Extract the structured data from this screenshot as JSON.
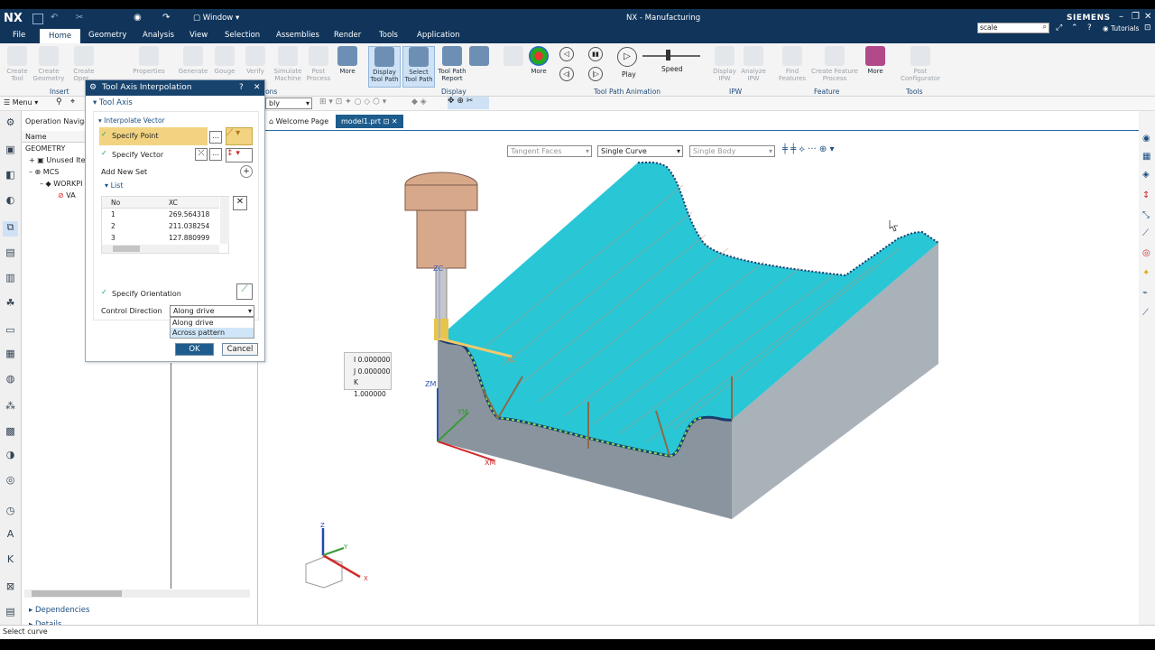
{
  "titlebar": {
    "logo": "NX",
    "window_menu": "Window",
    "app_title": "NX - Manufacturing",
    "brand": "SIEMENS"
  },
  "search": {
    "value": "scale"
  },
  "tutorials": "Tutorials",
  "menubar": {
    "items": [
      "File",
      "Home",
      "Geometry",
      "Analysis",
      "View",
      "Selection",
      "Assemblies",
      "Render",
      "Tools",
      "Application"
    ]
  },
  "ribbon": {
    "insert": [
      {
        "label": "Create Tool"
      },
      {
        "label": "Create Geometry"
      },
      {
        "label": "Create Oper..."
      },
      {
        "label": "Properties"
      },
      {
        "label": "Generate"
      },
      {
        "label": "Gouge"
      },
      {
        "label": "Verify"
      },
      {
        "label": "Simulate Machine"
      },
      {
        "label": "Post Process"
      }
    ],
    "more1": "More",
    "display_buttons": [
      {
        "label": "Display Tool Path"
      },
      {
        "label": "Select Tool Path"
      },
      {
        "label": "Tool Path Report"
      }
    ],
    "more2": "More",
    "play": "Play",
    "speed": "Speed",
    "ipw": [
      {
        "label": "Display IPW"
      },
      {
        "label": "Analyze IPW"
      }
    ],
    "feature": [
      {
        "label": "Find Features"
      },
      {
        "label": "Create Feature Process"
      },
      {
        "label": "More"
      }
    ],
    "tools": [
      {
        "label": "Post Configurator"
      }
    ],
    "groups": {
      "insert": "Insert",
      "ops": "ions",
      "display": "Display",
      "animation": "Tool Path Animation",
      "ipw": "IPW",
      "feature": "Feature",
      "tools": "Tools"
    }
  },
  "toolbar2": {
    "menu": "Menu",
    "assembly_dd": "bly"
  },
  "tabs": [
    {
      "label": "Welcome Page"
    },
    {
      "label": "model1.prt"
    }
  ],
  "navigator": {
    "title": "Operation Navigat",
    "col_name": "Name",
    "root": "GEOMETRY",
    "items": [
      "Unused Item",
      "MCS",
      "WORKPI",
      "VA"
    ],
    "dependencies": "Dependencies",
    "details": "Details"
  },
  "selection_filters": {
    "faces": "Tangent Faces",
    "curve": "Single Curve",
    "body": "Single Body"
  },
  "dialog": {
    "title": "Tool Axis Interpolation",
    "section_tool_axis": "Tool Axis",
    "section_interp": "Interpolate Vector",
    "specify_point": "Specify Point",
    "specify_vector": "Specify Vector",
    "add_new_set": "Add New Set",
    "list_label": "List",
    "col_no": "No",
    "col_xc": "XC",
    "rows": [
      {
        "no": "1",
        "xc": "269.564318"
      },
      {
        "no": "2",
        "xc": "211.038254"
      },
      {
        "no": "3",
        "xc": "127.880999"
      }
    ],
    "specify_orientation": "Specify Orientation",
    "control_direction_label": "Control Direction",
    "control_direction_value": "Along drive",
    "options": [
      "Along drive",
      "Across pattern"
    ],
    "ok": "OK",
    "cancel": "Cancel"
  },
  "vector_box": {
    "i": "I  0.000000",
    "j": "J  0.000000",
    "k": "K  1.000000"
  },
  "axis_labels": {
    "zc": "ZC",
    "xc": "XC",
    "zm": "ZM",
    "ym": "YM",
    "xm": "XM",
    "triad_z": "Z",
    "triad_y": "Y",
    "triad_x": "X"
  },
  "statusbar": {
    "text": "Select curve"
  }
}
